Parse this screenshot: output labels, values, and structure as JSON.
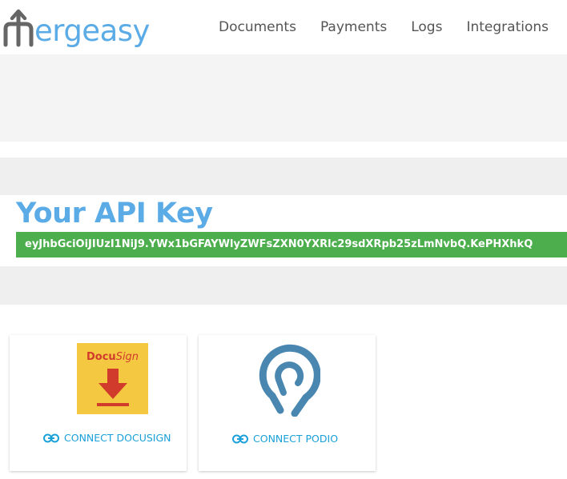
{
  "brand": {
    "logo_text": "ergeasy",
    "primary_color": "#5aabe6"
  },
  "nav": {
    "items": [
      {
        "label": "Documents"
      },
      {
        "label": "Payments"
      },
      {
        "label": "Logs"
      },
      {
        "label": "Integrations"
      }
    ]
  },
  "api": {
    "title": "Your API Key",
    "key": "eyJhbGciOiJIUzI1NiJ9.YWx1bGFAYWlyZWFsZXN0YXRlc29sdXRpb25zLmNvbQ.KePHXhkQ",
    "key_bg_color": "#4cae4c"
  },
  "integrations": {
    "docusign": {
      "logo_wordmark_main": "Docu",
      "logo_wordmark_sign": "Sign",
      "connect_label": "CONNECT DOCUSIGN",
      "icon": "link-icon"
    },
    "podio": {
      "connect_label": "CONNECT PODIO",
      "icon": "link-icon"
    },
    "link_color": "#1aa0d8"
  }
}
